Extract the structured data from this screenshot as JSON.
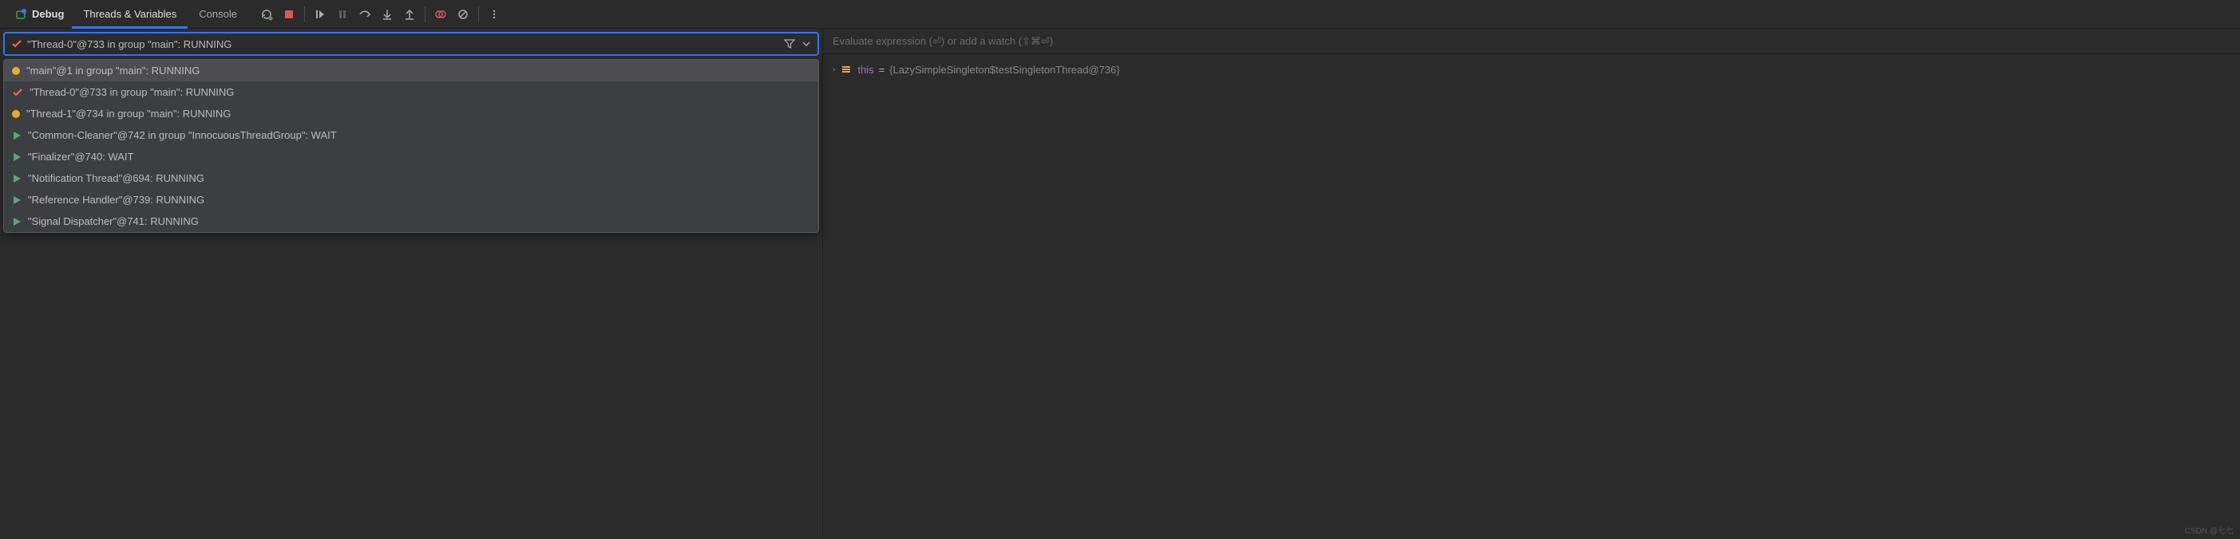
{
  "toolbar": {
    "debug_label": "Debug",
    "tabs": [
      {
        "label": "Threads & Variables",
        "active": true
      },
      {
        "label": "Console",
        "active": false
      }
    ]
  },
  "thread_selector": {
    "current": "\"Thread-0\"@733 in group \"main\": RUNNING"
  },
  "threads": [
    {
      "icon": "circle-orange",
      "label": "\"main\"@1 in group \"main\": RUNNING",
      "highlighted": true
    },
    {
      "icon": "check",
      "label": "\"Thread-0\"@733 in group \"main\": RUNNING"
    },
    {
      "icon": "circle-orange",
      "label": "\"Thread-1\"@734 in group \"main\": RUNNING"
    },
    {
      "icon": "play",
      "label": "\"Common-Cleaner\"@742 in group \"InnocuousThreadGroup\": WAIT"
    },
    {
      "icon": "play",
      "label": "\"Finalizer\"@740: WAIT"
    },
    {
      "icon": "play",
      "label": "\"Notification Thread\"@694: RUNNING"
    },
    {
      "icon": "play",
      "label": "\"Reference Handler\"@739: RUNNING"
    },
    {
      "icon": "play",
      "label": "\"Signal Dispatcher\"@741: RUNNING"
    }
  ],
  "eval_placeholder": "Evaluate expression (⏎) or add a watch (⇧⌘⏎)",
  "vars": {
    "this_name": "this",
    "this_equals": " = ",
    "this_value": "{LazySimpleSingleton$testSingletonThread@736}"
  },
  "watermark": "CSDN @七七"
}
